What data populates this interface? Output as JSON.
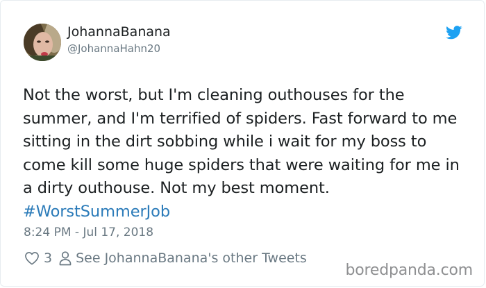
{
  "tweet": {
    "author": {
      "display_name": "JohannaBanana",
      "handle": "@JohannaHahn20",
      "avatar_icon": "user-photo"
    },
    "brand_icon": "twitter-bird-icon",
    "brand_color": "#1da1f2",
    "text": "Not the worst, but I'm cleaning outhouses for the summer, and I'm terrified of spiders. Fast forward to me sitting in the dirt sobbing while i wait for my boss to come kill some huge spiders that were waiting for me in a dirty outhouse. Not my best moment. ",
    "hashtag": "#WorstSummerJob",
    "hashtag_color": "#2b7bb9",
    "timestamp": "8:24 PM - Jul 17, 2018",
    "actions": {
      "like_icon": "heart-icon",
      "like_count": "3",
      "profile_icon": "person-icon",
      "profile_link_label": "See JohannaBanana's other Tweets"
    }
  },
  "watermark": "boredpanda.com"
}
